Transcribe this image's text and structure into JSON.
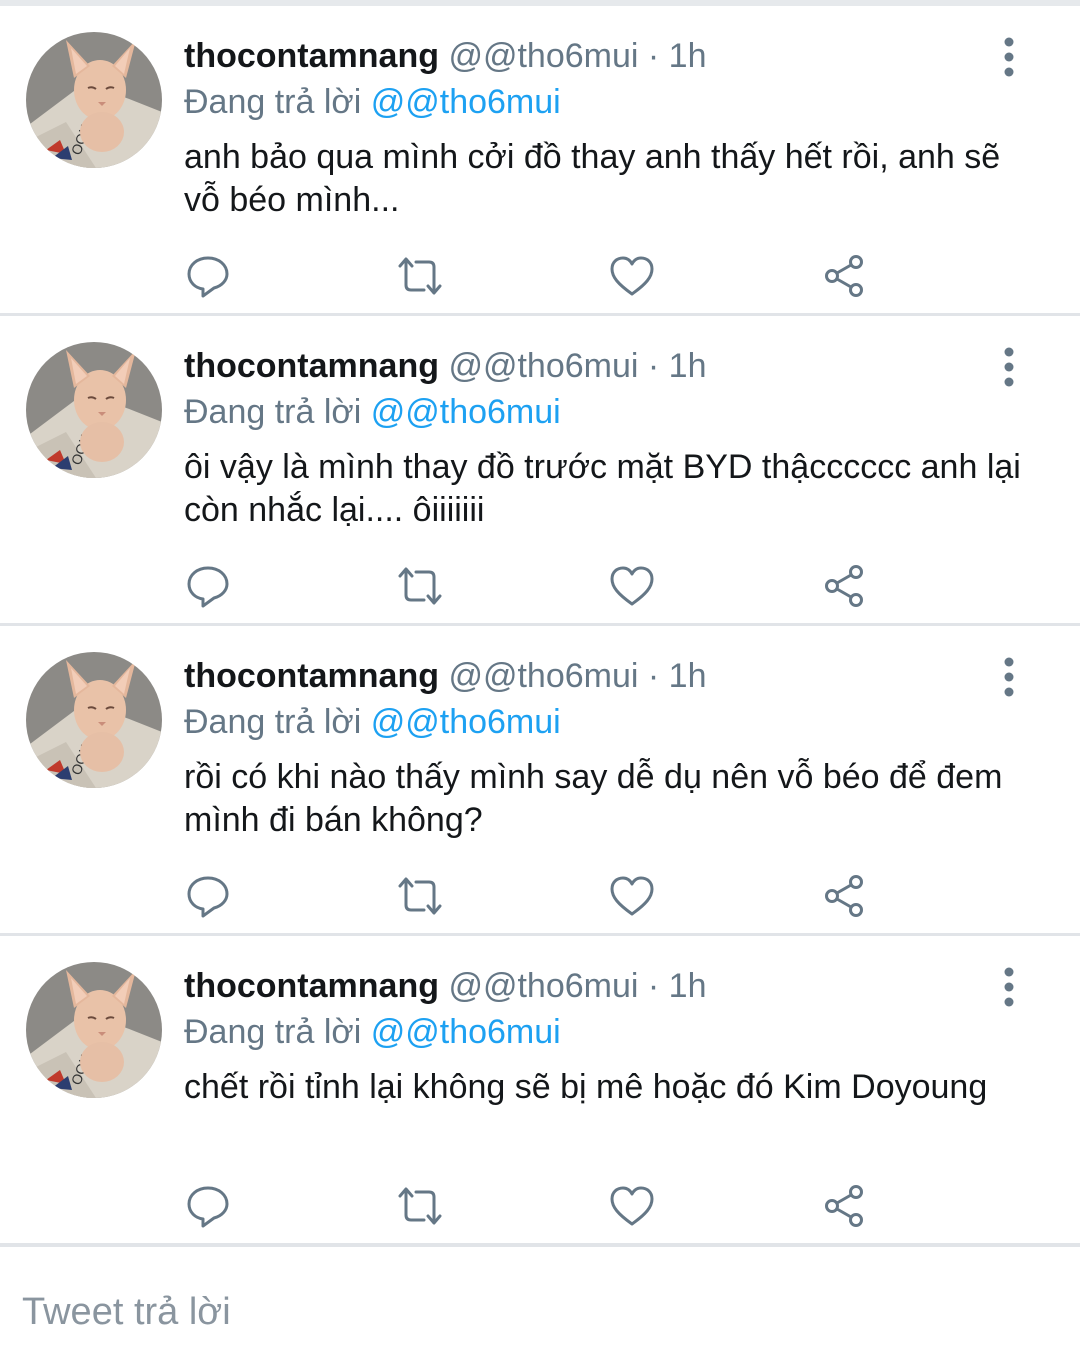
{
  "tweets": [
    {
      "username": "thocontamnang",
      "handle": "@@tho6mui",
      "separator": "·",
      "time": "1h",
      "reply_prefix": "Đang trả lời",
      "reply_handle": "@@tho6mui",
      "text": "anh bảo qua mình cởi đồ thay anh thấy hết rồi, anh sẽ vỗ béo mình..."
    },
    {
      "username": "thocontamnang",
      "handle": "@@tho6mui",
      "separator": "·",
      "time": "1h",
      "reply_prefix": "Đang trả lời",
      "reply_handle": "@@tho6mui",
      "text": "ôi vậy là mình thay đồ trước mặt BYD thậcccccc anh lại còn nhắc lại.... ôiiiiiii"
    },
    {
      "username": "thocontamnang",
      "handle": "@@tho6mui",
      "separator": "·",
      "time": "1h",
      "reply_prefix": "Đang trả lời",
      "reply_handle": "@@tho6mui",
      "text": "rồi có khi nào thấy mình say dễ dụ nên vỗ béo để đem mình đi bán không?"
    },
    {
      "username": "thocontamnang",
      "handle": "@@tho6mui",
      "separator": "·",
      "time": "1h",
      "reply_prefix": "Đang trả lời",
      "reply_handle": "@@tho6mui",
      "text": "chết rồi tỉnh lại không sẽ bị mê hoặc đó Kim Doyoung"
    }
  ],
  "composer": {
    "placeholder": "Tweet trả lời"
  },
  "colors": {
    "link": "#1da1f2",
    "muted": "#657786",
    "divider": "#e1e4e8",
    "icon": "#657786"
  },
  "icons": [
    "reply-icon",
    "retweet-icon",
    "like-icon",
    "share-icon",
    "more-options-icon",
    "avatar-cat-photo"
  ]
}
